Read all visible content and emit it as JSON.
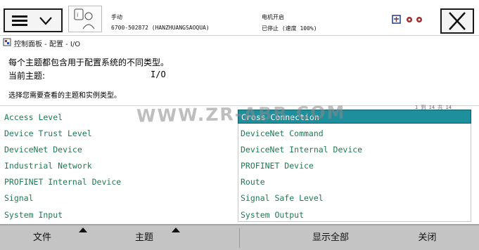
{
  "header": {
    "operator_mode": "手动",
    "controller_name": "6700-502872 (HANZHUANGSAOQUA)",
    "motor_status": "电机开启",
    "program_status": "已停止 (速度 100%)"
  },
  "breadcrumb": "控制面板 - 配置 - I/O",
  "info": {
    "description": "每个主题都包含用于配置系统的不同类型。",
    "current_topic_label": "当前主题:",
    "current_topic_value": "I/O",
    "instruction": "选择您需要查看的主题和实例类型。"
  },
  "page_count": "1 到 14 共 14",
  "watermark": "WWW.ZR-ABB.COM",
  "types_left": [
    "Access Level",
    "Device Trust Level",
    "DeviceNet Device",
    "Industrial Network",
    "PROFINET Internal Device",
    "Signal",
    "System Input"
  ],
  "types_right": [
    "Cross Connection",
    "DeviceNet Command",
    "DeviceNet Internal Device",
    "PROFINET Device",
    "Route",
    "Signal Safe Level",
    "System Output"
  ],
  "footer": {
    "file": "文件",
    "topic": "主题",
    "show_all": "显示全部",
    "close": "关闭"
  },
  "colors": {
    "selected_bg": "#1e8f9d",
    "item_text": "#1f7a53",
    "bottom_bar": "#c4c4c4"
  },
  "icons": {
    "menu": "hamburger-icon",
    "dropdown": "chevron-down-icon",
    "operator": "operator-icon",
    "close": "close-icon",
    "status": "robot-status-icons",
    "breadcrumb": "control-panel-icon"
  }
}
